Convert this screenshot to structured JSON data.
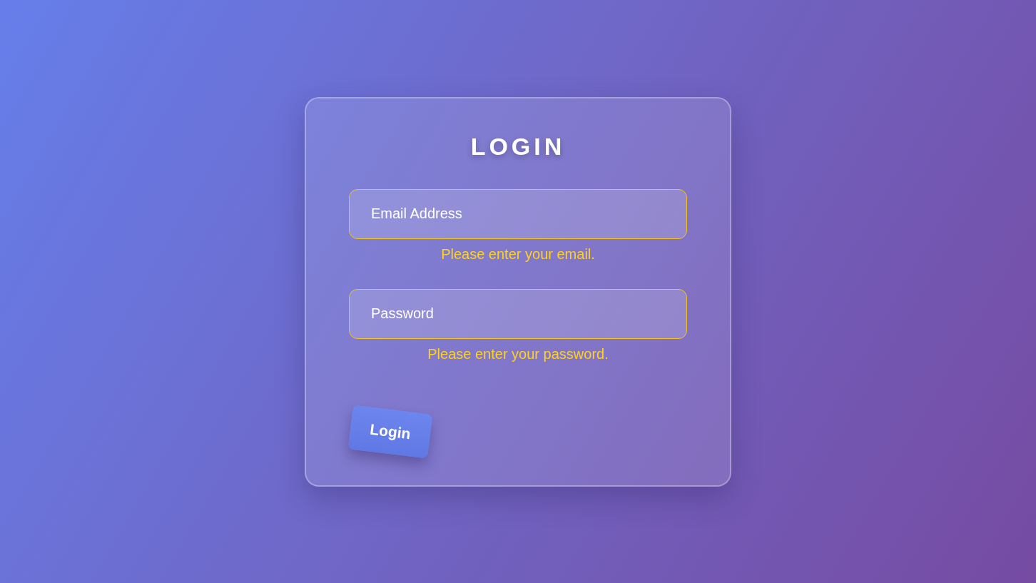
{
  "title": "LOGIN",
  "fields": [
    {
      "placeholder": "Email Address",
      "invalid": true,
      "error": "Please enter your email."
    },
    {
      "placeholder": "Password",
      "invalid": true,
      "error": "Please enter your password."
    }
  ],
  "button": {
    "label": "Login"
  }
}
